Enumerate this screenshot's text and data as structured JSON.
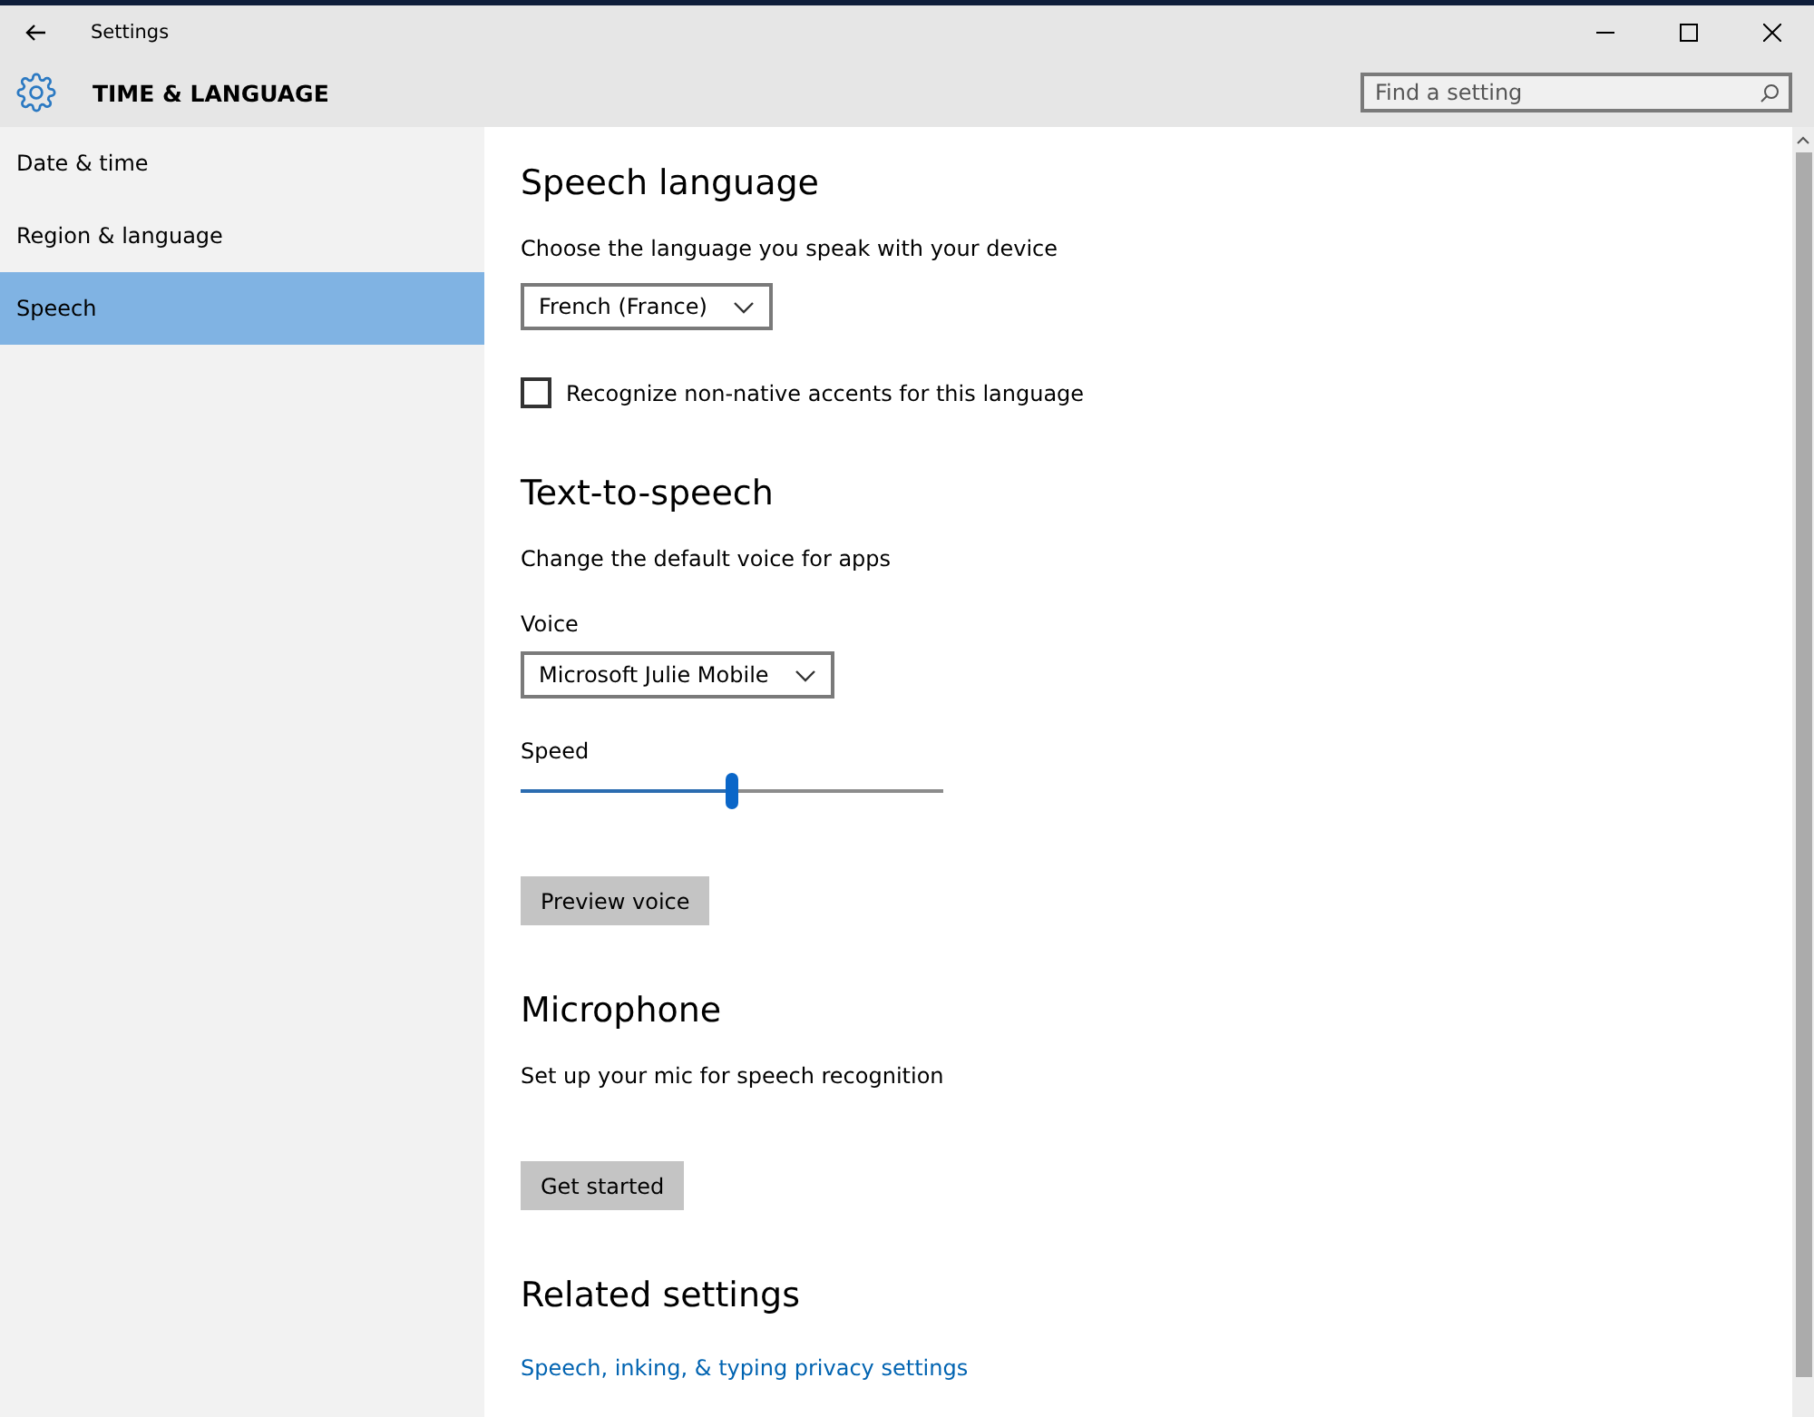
{
  "window": {
    "title": "Settings"
  },
  "header": {
    "title": "TIME & LANGUAGE",
    "search": {
      "placeholder": "Find a setting"
    }
  },
  "sidebar": {
    "items": [
      {
        "label": "Date & time",
        "selected": false
      },
      {
        "label": "Region & language",
        "selected": false
      },
      {
        "label": "Speech",
        "selected": true
      }
    ]
  },
  "sections": [
    {
      "heading": "Speech language",
      "items": [
        {
          "kind": "text",
          "text": "Choose the language you speak with your device"
        },
        {
          "kind": "dropdown",
          "value": "French (France)"
        },
        {
          "kind": "checkbox",
          "label": "Recognize non-native accents for this language",
          "checked": false
        }
      ]
    },
    {
      "heading": "Text-to-speech",
      "items": [
        {
          "kind": "text",
          "text": "Change the default voice for apps"
        },
        {
          "kind": "label",
          "text": "Voice"
        },
        {
          "kind": "dropdown",
          "value": "Microsoft Julie Mobile"
        },
        {
          "kind": "label",
          "text": "Speed"
        },
        {
          "kind": "slider",
          "level": 0.5
        },
        {
          "kind": "button",
          "label": "Preview voice"
        }
      ]
    },
    {
      "heading": "Microphone",
      "items": [
        {
          "kind": "text",
          "text": "Set up your mic for speech recognition"
        },
        {
          "kind": "button",
          "label": "Get started"
        }
      ]
    },
    {
      "heading": "Related settings",
      "items": [
        {
          "kind": "link",
          "text": "Speech, inking, & typing privacy settings"
        }
      ]
    }
  ]
}
